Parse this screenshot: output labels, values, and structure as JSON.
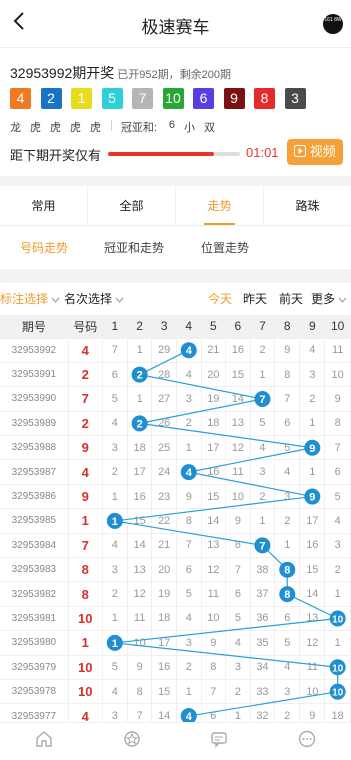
{
  "header": {
    "title": "极速赛车",
    "logo_text": "161 8W"
  },
  "draw": {
    "issue_label": "32953992期开奖",
    "sub_label": "已开952期，剩余200期",
    "balls": [
      {
        "value": "4",
        "color": "#f07a22"
      },
      {
        "value": "2",
        "color": "#1b73c8"
      },
      {
        "value": "1",
        "color": "#e8dc1c"
      },
      {
        "value": "5",
        "color": "#2ed0d8"
      },
      {
        "value": "7",
        "color": "#b5b5b5"
      },
      {
        "value": "10",
        "color": "#27a733"
      },
      {
        "value": "6",
        "color": "#5a3fe0"
      },
      {
        "value": "9",
        "color": "#7b1212"
      },
      {
        "value": "8",
        "color": "#e42a2a"
      },
      {
        "value": "3",
        "color": "#4a4a4a"
      }
    ],
    "tags": [
      "龙",
      "虎",
      "虎",
      "虎",
      "虎"
    ],
    "sum_label": "冠亚和:",
    "sum_values": [
      "6",
      "小",
      "双"
    ],
    "countdown_label": "距下期开奖仅有",
    "progress": 0.8,
    "time": "01:01",
    "video_label": "视频"
  },
  "tabs": [
    {
      "label": "常用",
      "active": false
    },
    {
      "label": "全部",
      "active": false
    },
    {
      "label": "走势",
      "active": true
    },
    {
      "label": "路珠",
      "active": false
    }
  ],
  "subtabs": [
    {
      "label": "号码走势",
      "active": true
    },
    {
      "label": "冠亚和走势",
      "active": false
    },
    {
      "label": "位置走势",
      "active": false
    }
  ],
  "filters": {
    "mark": "标注选择",
    "rank": "名次选择",
    "today": "今天",
    "yesterday": "昨天",
    "day_before": "前天",
    "more": "更多"
  },
  "table": {
    "headers": [
      "期号",
      "号码",
      "1",
      "2",
      "3",
      "4",
      "5",
      "6",
      "7",
      "8",
      "9",
      "10"
    ],
    "rows": [
      {
        "issue": "32953992",
        "num": 4,
        "miss": [
          7,
          1,
          29,
          null,
          21,
          16,
          2,
          9,
          4,
          11
        ]
      },
      {
        "issue": "32953991",
        "num": 2,
        "miss": [
          6,
          null,
          28,
          4,
          20,
          15,
          1,
          8,
          3,
          10
        ]
      },
      {
        "issue": "32953990",
        "num": 7,
        "miss": [
          5,
          1,
          27,
          3,
          19,
          14,
          null,
          7,
          2,
          9
        ]
      },
      {
        "issue": "32953989",
        "num": 2,
        "miss": [
          4,
          null,
          26,
          2,
          18,
          13,
          5,
          6,
          1,
          8
        ]
      },
      {
        "issue": "32953988",
        "num": 9,
        "miss": [
          3,
          18,
          25,
          1,
          17,
          12,
          4,
          5,
          null,
          7
        ]
      },
      {
        "issue": "32953987",
        "num": 4,
        "miss": [
          2,
          17,
          24,
          null,
          16,
          11,
          3,
          4,
          1,
          6
        ]
      },
      {
        "issue": "32953986",
        "num": 9,
        "miss": [
          1,
          16,
          23,
          9,
          15,
          10,
          2,
          3,
          null,
          5
        ]
      },
      {
        "issue": "32953985",
        "num": 1,
        "miss": [
          null,
          15,
          22,
          8,
          14,
          9,
          1,
          2,
          17,
          4
        ]
      },
      {
        "issue": "32953984",
        "num": 7,
        "miss": [
          4,
          14,
          21,
          7,
          13,
          8,
          null,
          1,
          16,
          3
        ]
      },
      {
        "issue": "32953983",
        "num": 8,
        "miss": [
          3,
          13,
          20,
          6,
          12,
          7,
          38,
          null,
          15,
          2
        ]
      },
      {
        "issue": "32953982",
        "num": 8,
        "miss": [
          2,
          12,
          19,
          5,
          11,
          6,
          37,
          null,
          14,
          1
        ]
      },
      {
        "issue": "32953981",
        "num": 10,
        "miss": [
          1,
          11,
          18,
          4,
          10,
          5,
          36,
          6,
          13,
          null
        ]
      },
      {
        "issue": "32953980",
        "num": 1,
        "miss": [
          null,
          10,
          17,
          3,
          9,
          4,
          35,
          5,
          12,
          1
        ]
      },
      {
        "issue": "32953979",
        "num": 10,
        "miss": [
          5,
          9,
          16,
          2,
          8,
          3,
          34,
          4,
          11,
          null
        ]
      },
      {
        "issue": "32953978",
        "num": 10,
        "miss": [
          4,
          8,
          15,
          1,
          7,
          2,
          33,
          3,
          10,
          null
        ]
      },
      {
        "issue": "32953977",
        "num": 4,
        "miss": [
          3,
          7,
          14,
          null,
          6,
          1,
          32,
          2,
          9,
          18
        ]
      }
    ]
  },
  "colors": {
    "accent": "#f39a2c",
    "line": "#2aa0d8",
    "ball": "#1f8fd1",
    "red": "#d8302c"
  },
  "bottom_nav": [
    {
      "icon": "home-icon"
    },
    {
      "icon": "star-badge-icon"
    },
    {
      "icon": "chat-icon"
    },
    {
      "icon": "more-icon"
    }
  ]
}
